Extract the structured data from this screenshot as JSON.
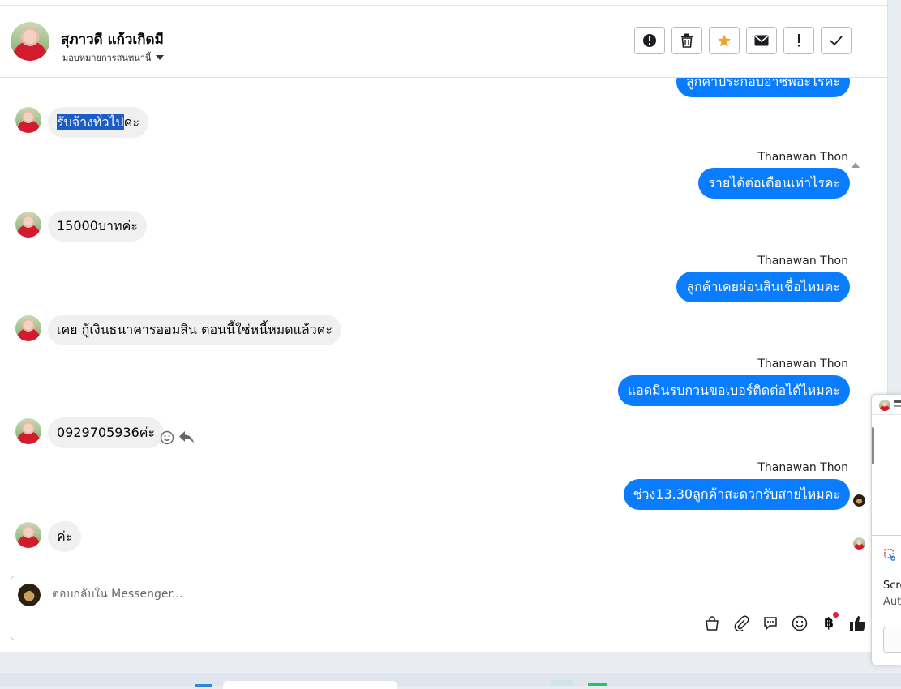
{
  "header": {
    "contact_name": "สุภาวดี แก้วเกิดมี",
    "assignment": "มอบหมายการสนทนานี้"
  },
  "messages": {
    "top_partial": "ลูกค้าประกอบอาชีพอะไรคะ",
    "m1_selected": "รับจ้างทั่วไป",
    "m1_rest": "ค่ะ",
    "agent_name_1": "Thanawan Thon",
    "m2": "รายได้ต่อเดือนเท่าไรคะ",
    "m3": "15000บาทค่ะ",
    "agent_name_2": "Thanawan Thon",
    "m4": "ลูกค้าเคยผ่อนสินเชื่อไหมคะ",
    "m5": "เคย กู้เงินธนาคารออมสิน   ตอนนี้ใช่หนี้หมดแล้วค่ะ",
    "agent_name_3": "Thanawan Thon",
    "m6": "แอดมินรบกวนขอเบอร์ติดต่อได้ไหมคะ",
    "m7": "0929705936ค่ะ",
    "agent_name_4": "Thanawan Thon",
    "m8": "ช่วง13.30ลูกค้าสะดวกรับสายไหมคะ",
    "m9": "ค่ะ"
  },
  "composer": {
    "placeholder": "ตอบกลับใน Messenger..."
  },
  "side_panel": {
    "title_partial": "Scre",
    "subtitle_partial": "Aut"
  },
  "colors": {
    "accent": "#0a7cff",
    "star": "#f7a02a",
    "selection": "#1a5dc8"
  }
}
